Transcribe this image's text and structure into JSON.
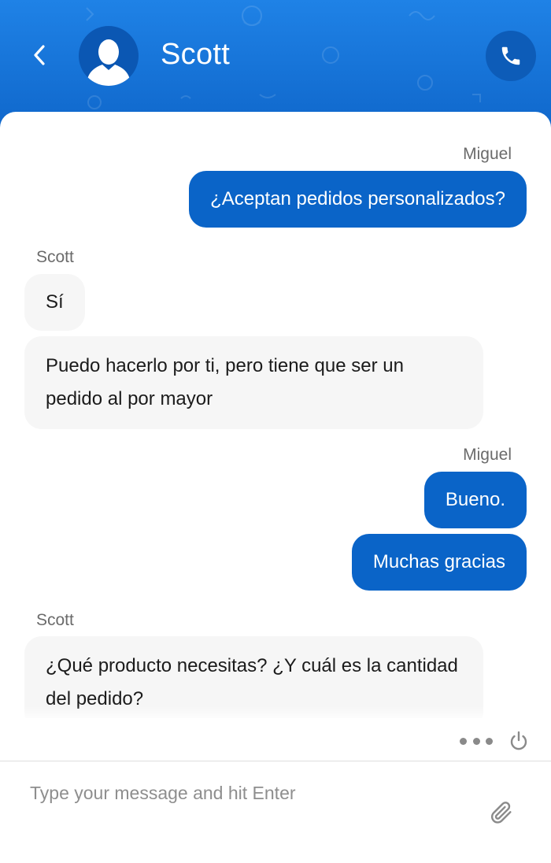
{
  "header": {
    "contact_name": "Scott",
    "back_icon": "chevron-left-icon",
    "avatar_icon": "user-silhouette-icon",
    "call_icon": "phone-icon"
  },
  "messages": [
    {
      "sender": "Miguel",
      "direction": "outgoing",
      "texts": [
        "¿Aceptan pedidos personalizados?"
      ]
    },
    {
      "sender": "Scott",
      "direction": "incoming",
      "texts": [
        "Sí",
        "Puedo hacerlo por ti, pero tiene que ser un pedido al por mayor"
      ]
    },
    {
      "sender": "Miguel",
      "direction": "outgoing",
      "texts": [
        "Bueno.",
        "Muchas gracias"
      ]
    },
    {
      "sender": "Scott",
      "direction": "incoming",
      "texts": [
        "¿Qué producto necesitas? ¿Y cuál es la cantidad del pedido?"
      ]
    }
  ],
  "toolbar": {
    "more_icon": "more-dots-icon",
    "power_icon": "power-icon"
  },
  "composer": {
    "placeholder": "Type your message and hit Enter",
    "value": "",
    "attach_icon": "paperclip-icon"
  },
  "colors": {
    "header_top": "#1f82e6",
    "header_bottom": "#1068cc",
    "outgoing_bubble": "#0a64c8",
    "incoming_bubble": "#f6f6f6",
    "call_button": "#0d5cb8"
  }
}
